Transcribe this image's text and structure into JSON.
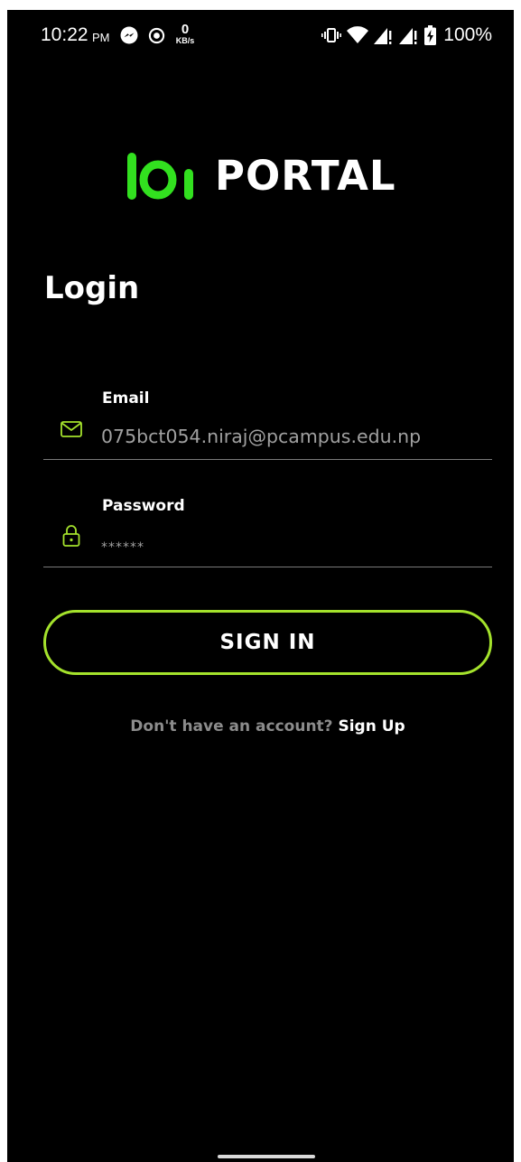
{
  "status_bar": {
    "time": "10:22",
    "ampm": "PM",
    "net_speed_value": "0",
    "net_speed_unit": "KB/s",
    "battery_percent": "100%",
    "icons": [
      "messenger-icon",
      "record-icon",
      "vibrate-icon",
      "wifi-icon",
      "signal-icon",
      "signal-icon",
      "battery-charging-icon"
    ]
  },
  "logo": {
    "text": "PORTAL",
    "accent_color": "#32e01f"
  },
  "page": {
    "title": "Login"
  },
  "email_field": {
    "label": "Email",
    "value": "075bct054.niraj@pcampus.edu.np",
    "icon": "mail-icon"
  },
  "password_field": {
    "label": "Password",
    "value": "******",
    "icon": "lock-icon"
  },
  "sign_in_button": {
    "label": "SIGN IN",
    "border_color": "#a4e22c"
  },
  "signup": {
    "prompt": "Don't have an account?",
    "link": "Sign Up"
  },
  "colors": {
    "background": "#000000",
    "icon_accent": "#a4e22c",
    "muted_text": "#8c8c8c"
  }
}
